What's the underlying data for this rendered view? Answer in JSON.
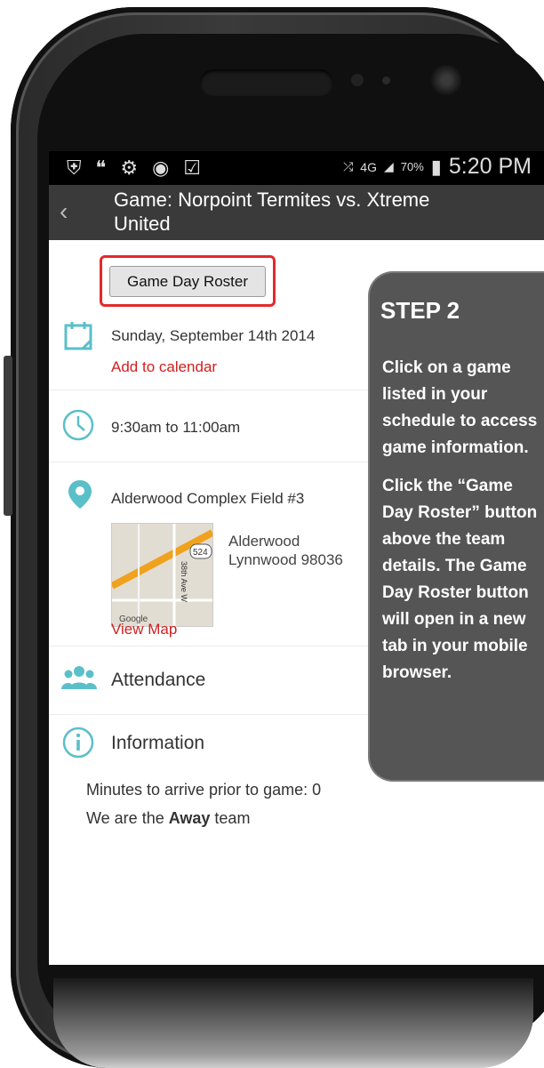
{
  "status": {
    "battery": "70%",
    "time": "5:20 PM",
    "network": "4G"
  },
  "header": {
    "title_line1": "Game: Norpoint Termites vs. Xtreme",
    "title_line2": "United"
  },
  "roster_button": "Game Day Roster",
  "date": {
    "text": "Sunday, September 14th 2014",
    "add_to_calendar": "Add to calendar"
  },
  "time_range": "9:30am to 11:00am",
  "location": {
    "name": "Alderwood Complex Field #3",
    "address_line1": "Alderwood",
    "address_line2": "Lynnwood 98036",
    "view_map": "View Map",
    "map_road_label": "524",
    "map_street_label": "38th Ave W",
    "map_attribution": "Google"
  },
  "attendance": "Attendance",
  "information": {
    "label": "Information",
    "minutes": "Minutes to arrive prior to game: 0",
    "team_prefix": "We are the ",
    "team_bold": "Away",
    "team_suffix": " team"
  },
  "overlay": {
    "title": "STEP 2",
    "paragraph1": "Click on a game\nlisted in your\nschedule to access\ngame information.",
    "paragraph2": "Click the “Game\nDay Roster” button\nabove the team\ndetails. The Game\nDay Roster button\nwill open in a new\ntab in your mobile\nbrowser."
  },
  "colors": {
    "accent_red": "#d1201f",
    "icon_teal": "#5bbfc9",
    "appbar": "#3a3a3a",
    "overlay": "#555555"
  }
}
